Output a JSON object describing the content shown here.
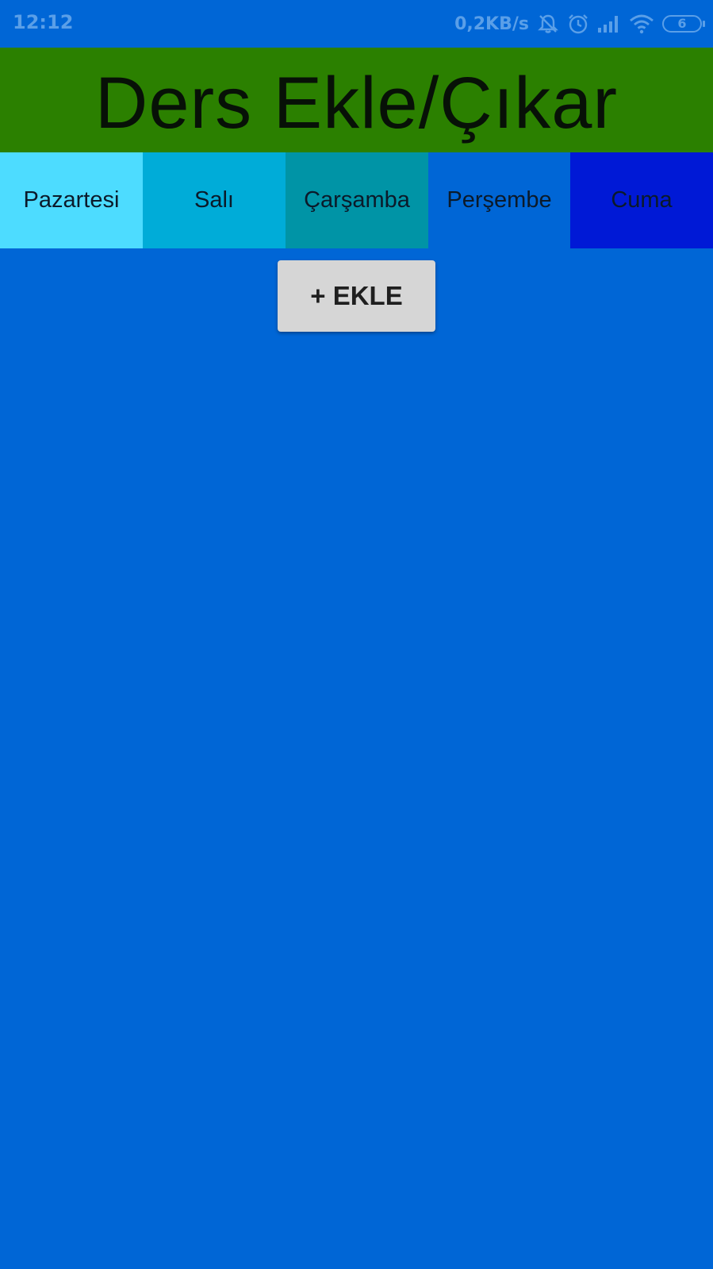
{
  "status_bar": {
    "time": "12:12",
    "network_speed": "0,2KB/s",
    "battery_level": "6",
    "icons": [
      "notifications-off-icon",
      "alarm-icon",
      "signal-icon",
      "wifi-icon",
      "battery-icon"
    ]
  },
  "header": {
    "title": "Ders Ekle/Çıkar"
  },
  "tabs": [
    {
      "label": "Pazartesi",
      "color": "#4ddcff"
    },
    {
      "label": "Salı",
      "color": "#00acd8"
    },
    {
      "label": "Çarşamba",
      "color": "#0094a6"
    },
    {
      "label": "Perşembe",
      "color": "#0066d6"
    },
    {
      "label": "Cuma",
      "color": "#0019d6"
    }
  ],
  "actions": {
    "add_label": "+ EKLE"
  },
  "colors": {
    "background": "#0066d6",
    "header": "#2b8000",
    "button": "#d6d6d6"
  }
}
